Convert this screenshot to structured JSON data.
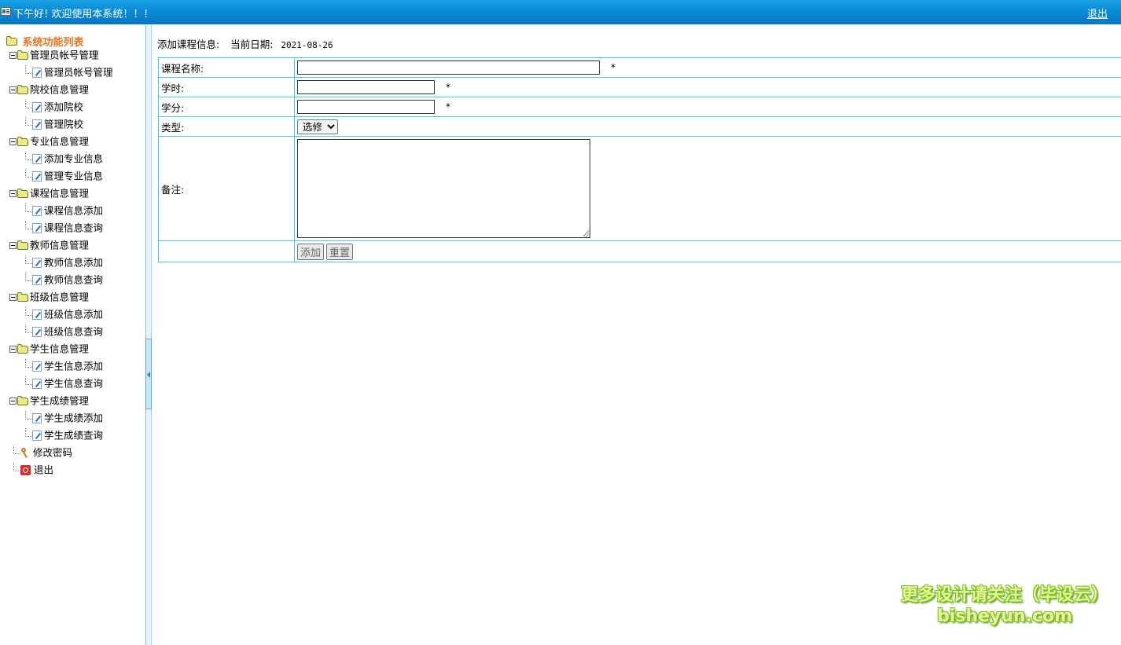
{
  "header": {
    "welcome": "下午好! 欢迎使用本系统！！！",
    "logout_label": "退出"
  },
  "sidebar": {
    "root_label": "系统功能列表",
    "groups": [
      {
        "label": "管理员帐号管理",
        "items": [
          "管理员帐号管理"
        ]
      },
      {
        "label": "院校信息管理",
        "items": [
          "添加院校",
          "管理院校"
        ]
      },
      {
        "label": "专业信息管理",
        "items": [
          "添加专业信息",
          "管理专业信息"
        ]
      },
      {
        "label": "课程信息管理",
        "items": [
          "课程信息添加",
          "课程信息查询"
        ]
      },
      {
        "label": "教师信息管理",
        "items": [
          "教师信息添加",
          "教师信息查询"
        ]
      },
      {
        "label": "班级信息管理",
        "items": [
          "班级信息添加",
          "班级信息查询"
        ]
      },
      {
        "label": "学生信息管理",
        "items": [
          "学生信息添加",
          "学生信息查询"
        ]
      },
      {
        "label": "学生成绩管理",
        "items": [
          "学生成绩添加",
          "学生成绩查询"
        ]
      }
    ],
    "change_password": "修改密码",
    "exit": "退出"
  },
  "main": {
    "title": "添加课程信息:",
    "date_label": "当前日期:",
    "date_value": "2021-08-26",
    "form": {
      "course_name_label": "课程名称:",
      "course_name_value": "",
      "hours_label": "学时:",
      "hours_value": "",
      "credit_label": "学分:",
      "credit_value": "",
      "type_label": "类型:",
      "type_selected": "选修",
      "note_label": "备注:",
      "note_value": "",
      "required_mark": "*",
      "add_button": "添加",
      "reset_button": "重置"
    }
  },
  "watermark": {
    "line1": "更多设计请关注（毕设云）",
    "line2": "bisheyun.com"
  },
  "icons": {
    "app": "app-window-icon",
    "folder": "folder-icon",
    "document": "edit-document-icon",
    "key": "key-icon",
    "exit": "power-exit-icon"
  },
  "colors": {
    "header_bg": "#0a8bd6",
    "tree_root": "#e8731e",
    "table_border": "#3fd0d6"
  }
}
